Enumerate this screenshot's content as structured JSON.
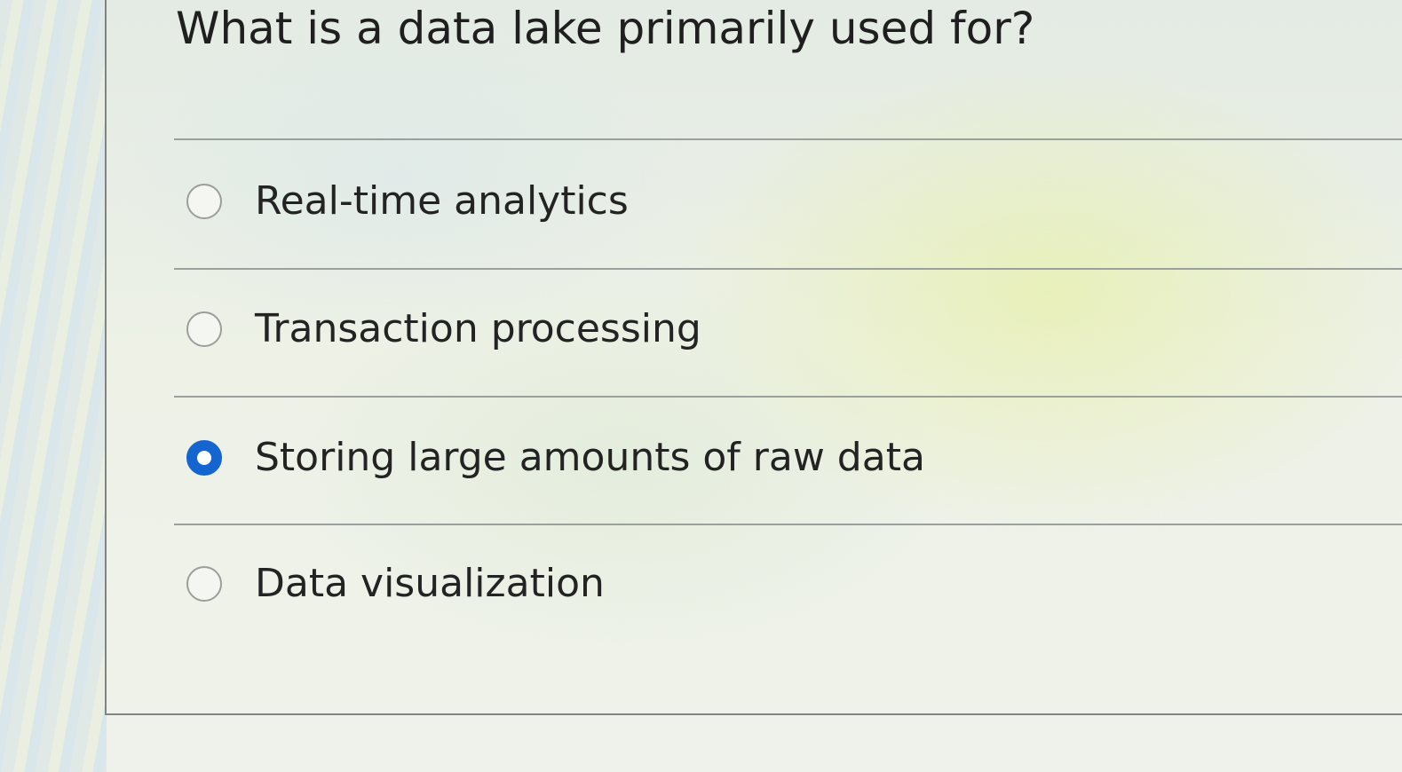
{
  "question": {
    "text": "What is a data lake primarily used for?"
  },
  "options": [
    {
      "label": "Real-time analytics",
      "selected": false
    },
    {
      "label": "Transaction processing",
      "selected": false
    },
    {
      "label": "Storing large amounts of raw data",
      "selected": true
    },
    {
      "label": "Data visualization",
      "selected": false
    }
  ],
  "colors": {
    "selected_radio": "#1565d1",
    "unselected_radio_border": "#9b9f9c"
  }
}
